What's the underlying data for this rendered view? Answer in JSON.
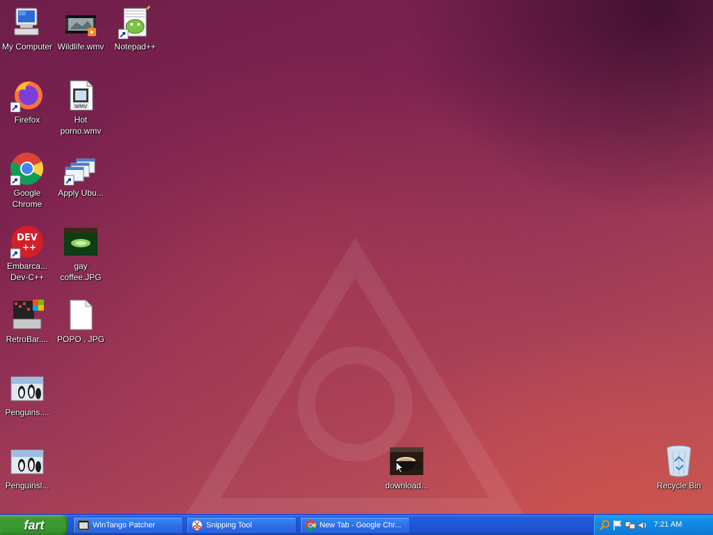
{
  "desktop": {
    "icons": {
      "my_computer": "My Computer",
      "wildlife": "Wildlife.wmv",
      "notepadpp": "Notepad++",
      "firefox": "Firefox",
      "hot_wmv": "Hot porno.wmv",
      "chrome": "Google Chrome",
      "apply_ubu": "Apply Ubu...",
      "devcpp": "Embarca... Dev-C++",
      "gay_coffee": "gay coffee.JPG",
      "retrobar": "RetroBar....",
      "popo": "POPO . JPG",
      "penguins1": "Penguins....",
      "penguins2": "Penguinsl...",
      "download": "download...",
      "recycle_bin": "Recycle Bin"
    },
    "wmv_badge": "WMV"
  },
  "taskbar": {
    "start_label": "fart",
    "buttons": {
      "wintango": "WinTango Patcher",
      "snipping": "Snipping Tool",
      "chrome_tab": "New Tab - Google Chr..."
    },
    "clock": "7:21 AM"
  },
  "colors": {
    "taskbar_blue": "#245edb",
    "start_green": "#3c9a34",
    "tray_blue": "#0f83e0"
  }
}
